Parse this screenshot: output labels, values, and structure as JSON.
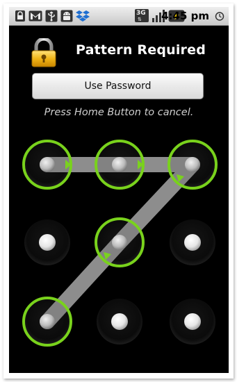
{
  "statusbar": {
    "icons": [
      "lock-notification-icon",
      "gmail-icon",
      "usb-icon",
      "android-debug-icon",
      "dropbox-icon"
    ],
    "network_label": "3G",
    "time": "4:45 pm"
  },
  "header": {
    "title": "Pattern Required"
  },
  "use_password_button": {
    "label": "Use Password"
  },
  "hint": "Press Home Button to cancel.",
  "pattern": {
    "dots": [
      {
        "row": 1,
        "col": 1,
        "selected": true
      },
      {
        "row": 1,
        "col": 2,
        "selected": true
      },
      {
        "row": 1,
        "col": 3,
        "selected": true
      },
      {
        "row": 2,
        "col": 1,
        "selected": false
      },
      {
        "row": 2,
        "col": 2,
        "selected": true
      },
      {
        "row": 2,
        "col": 3,
        "selected": false
      },
      {
        "row": 3,
        "col": 1,
        "selected": true
      },
      {
        "row": 3,
        "col": 2,
        "selected": false
      },
      {
        "row": 3,
        "col": 3,
        "selected": false
      }
    ],
    "sequence": [
      1,
      2,
      3,
      5,
      7
    ],
    "colors": {
      "ring": "#7ad21e",
      "path": "#8f8f8f",
      "dot": "#ffffff"
    }
  }
}
